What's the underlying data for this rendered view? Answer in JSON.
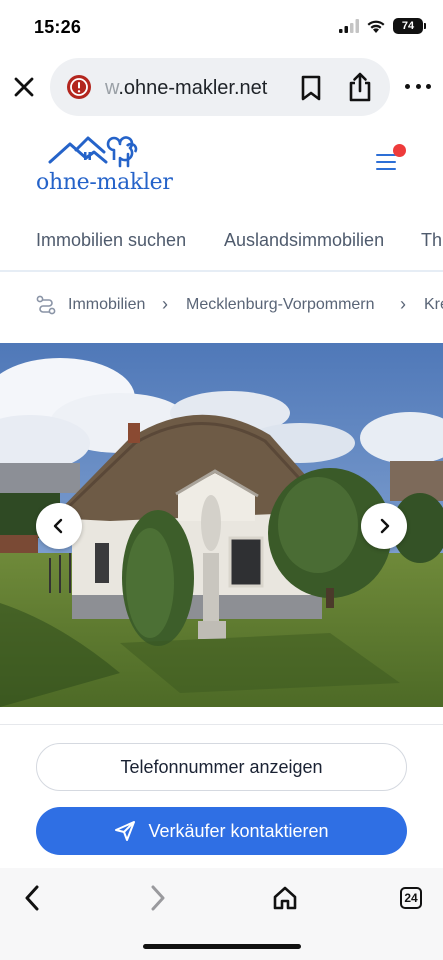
{
  "status": {
    "time": "15:26",
    "battery": "74"
  },
  "browser": {
    "url_faded": "w",
    "url_main": ".ohne-makler.net",
    "icons": [
      "close-icon",
      "warning-icon",
      "bookmark-icon",
      "share-icon",
      "more-icon"
    ]
  },
  "site": {
    "logo_text": "ohne-makler",
    "brand_color": "#2563c9",
    "notification_color": "#ee3b3b"
  },
  "nav": {
    "tabs": [
      "Immobilien suchen",
      "Auslandsimmobilien",
      "Th"
    ]
  },
  "breadcrumb": {
    "items": [
      "Immobilien",
      "Mecklenburg-Vorpommern",
      "Kre"
    ]
  },
  "actions": {
    "phone_label": "Telefonnummer anzeigen",
    "contact_label": "Verkäufer kontaktieren",
    "accent_color": "#2f6fe4"
  },
  "bottom_bar": {
    "tab_count": "24"
  }
}
